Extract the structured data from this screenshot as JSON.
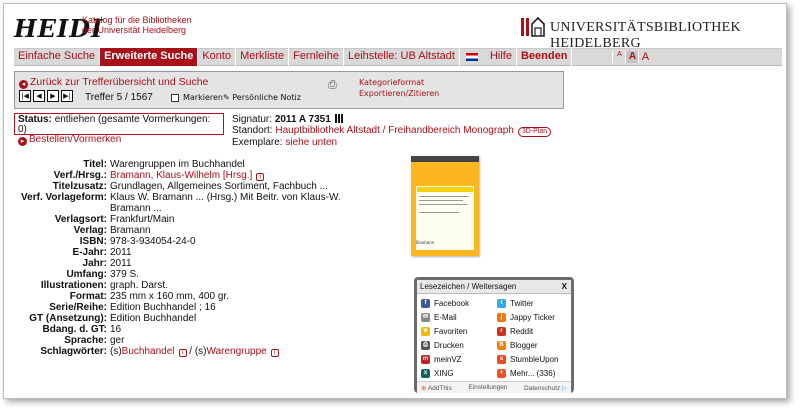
{
  "header": {
    "logo": "HEIDI",
    "logo_sub_line1": "Katalog für die Bibliotheken",
    "logo_sub_line2": "der Universität Heidelberg",
    "institution": "UNIVERSITÄTSBIBLIOTHEK HEIDELBERG"
  },
  "nav": {
    "items": [
      {
        "label": "Einfache Suche"
      },
      {
        "label": "Erweiterte Suche",
        "active": true
      },
      {
        "label": "Konto"
      },
      {
        "label": "Merkliste"
      },
      {
        "label": "Fernleihe"
      },
      {
        "label": "Leihstelle: UB Altstadt"
      }
    ],
    "flag_icon": "uk-flag-icon",
    "hilfe": "Hilfe",
    "beenden": "Beenden",
    "font_small": "A",
    "font_medium": "A",
    "font_large": "A"
  },
  "toolbar": {
    "back": "Zurück zur Trefferübersicht und Suche",
    "treffer": "Treffer 5 / 1567",
    "markieren": "Markieren",
    "notiz": "Persönliche Notiz",
    "kategorieformat": "Kategorieformat",
    "exportieren": "Exportieren/Zitieren"
  },
  "status": {
    "label": "Status:",
    "text": "entliehen (gesamte Vormerkungen: 0)",
    "action": "Bestellen/Vormerken"
  },
  "location": {
    "sig_label": "Signatur:",
    "sig_value": "2011 A 7351",
    "standort_label": "Standort:",
    "standort_value": "Hauptbibliothek Altstadt / Freihandbereich Monograph",
    "plan": "3D-Plan",
    "exemplare_label": "Exemplare:",
    "exemplare_value": "siehe unten"
  },
  "details": {
    "titel_l": "Titel:",
    "titel_v": "Warengruppen im Buchhandel",
    "verf_l": "Verf./Hrsg.:",
    "verf_v": "Bramann, Klaus-Wilhelm [Hrsg.]",
    "titelzusatz_l": "Titelzusatz:",
    "titelzusatz_v": "Grundlagen, Allgemeines Sortiment, Fachbuch ...",
    "vorlage_l": "Verf. Vorlageform:",
    "vorlage_v": "Klaus W. Bramann ... (Hrsg.) Mit Beitr. von Klaus-W. Bramann ...",
    "ort_l": "Verlagsort:",
    "ort_v": "Frankfurt/Main",
    "verlag_l": "Verlag:",
    "verlag_v": "Bramann",
    "isbn_l": "ISBN:",
    "isbn_v": "978-3-934054-24-0",
    "ejahr_l": "E-Jahr:",
    "ejahr_v": "2011",
    "jahr_l": "Jahr:",
    "jahr_v": "2011",
    "umfang_l": "Umfang:",
    "umfang_v": "379 S.",
    "illu_l": "Illustrationen:",
    "illu_v": "graph. Darst.",
    "format_l": "Format:",
    "format_v": "235 mm x 160 mm, 400 gr.",
    "serie_l": "Serie/Reihe:",
    "serie_v": "Edition Buchhandel ; 16",
    "gt_l": "GT (Ansetzung):",
    "gt_v": "Edition Buchhandel",
    "bdang_l": "Bdang. d. GT:",
    "bdang_v": "16",
    "sprache_l": "Sprache:",
    "sprache_v": "ger",
    "schlag_l": "Schlagwörter:",
    "schlag_pre1": "(s)",
    "schlag_v1": "Buchhandel",
    "schlag_sep": " / (s)",
    "schlag_v2": "Warengruppe"
  },
  "cover": {
    "title": "Warengruppen im Buchhandel",
    "publisher": "Bramann"
  },
  "share": {
    "title": "Lesezeichen / Weitersagen",
    "close": "X",
    "items": [
      {
        "label": "Facebook",
        "icon": "facebook-icon",
        "color": "#3b5998"
      },
      {
        "label": "Twitter",
        "icon": "twitter-icon",
        "color": "#33aaee"
      },
      {
        "label": "E-Mail",
        "icon": "email-icon",
        "color": "#8a8a8a"
      },
      {
        "label": "Jappy Ticker",
        "icon": "jappy-icon",
        "color": "#ee7711"
      },
      {
        "label": "Favoriten",
        "icon": "star-icon",
        "color": "#f2b90d"
      },
      {
        "label": "Reddit",
        "icon": "reddit-icon",
        "color": "#cc3322"
      },
      {
        "label": "Drucken",
        "icon": "printer-icon",
        "color": "#555555"
      },
      {
        "label": "Blogger",
        "icon": "blogger-icon",
        "color": "#f57d00"
      },
      {
        "label": "meinVZ",
        "icon": "meinvz-icon",
        "color": "#c71f1f"
      },
      {
        "label": "StumbleUpon",
        "icon": "stumbleupon-icon",
        "color": "#eb4924"
      },
      {
        "label": "XING",
        "icon": "xing-icon",
        "color": "#126567"
      },
      {
        "label": "Mehr... (336)",
        "icon": "plus-icon",
        "color": "#e8562a"
      }
    ],
    "addthis": "AddThis",
    "einstellungen": "Einstellungen",
    "datenschutz": "Datenschutz"
  },
  "colors": {
    "accent": "#a8101a",
    "nav_bg": "#d9d9d9",
    "toolbar_bg": "#e4e4e4"
  }
}
